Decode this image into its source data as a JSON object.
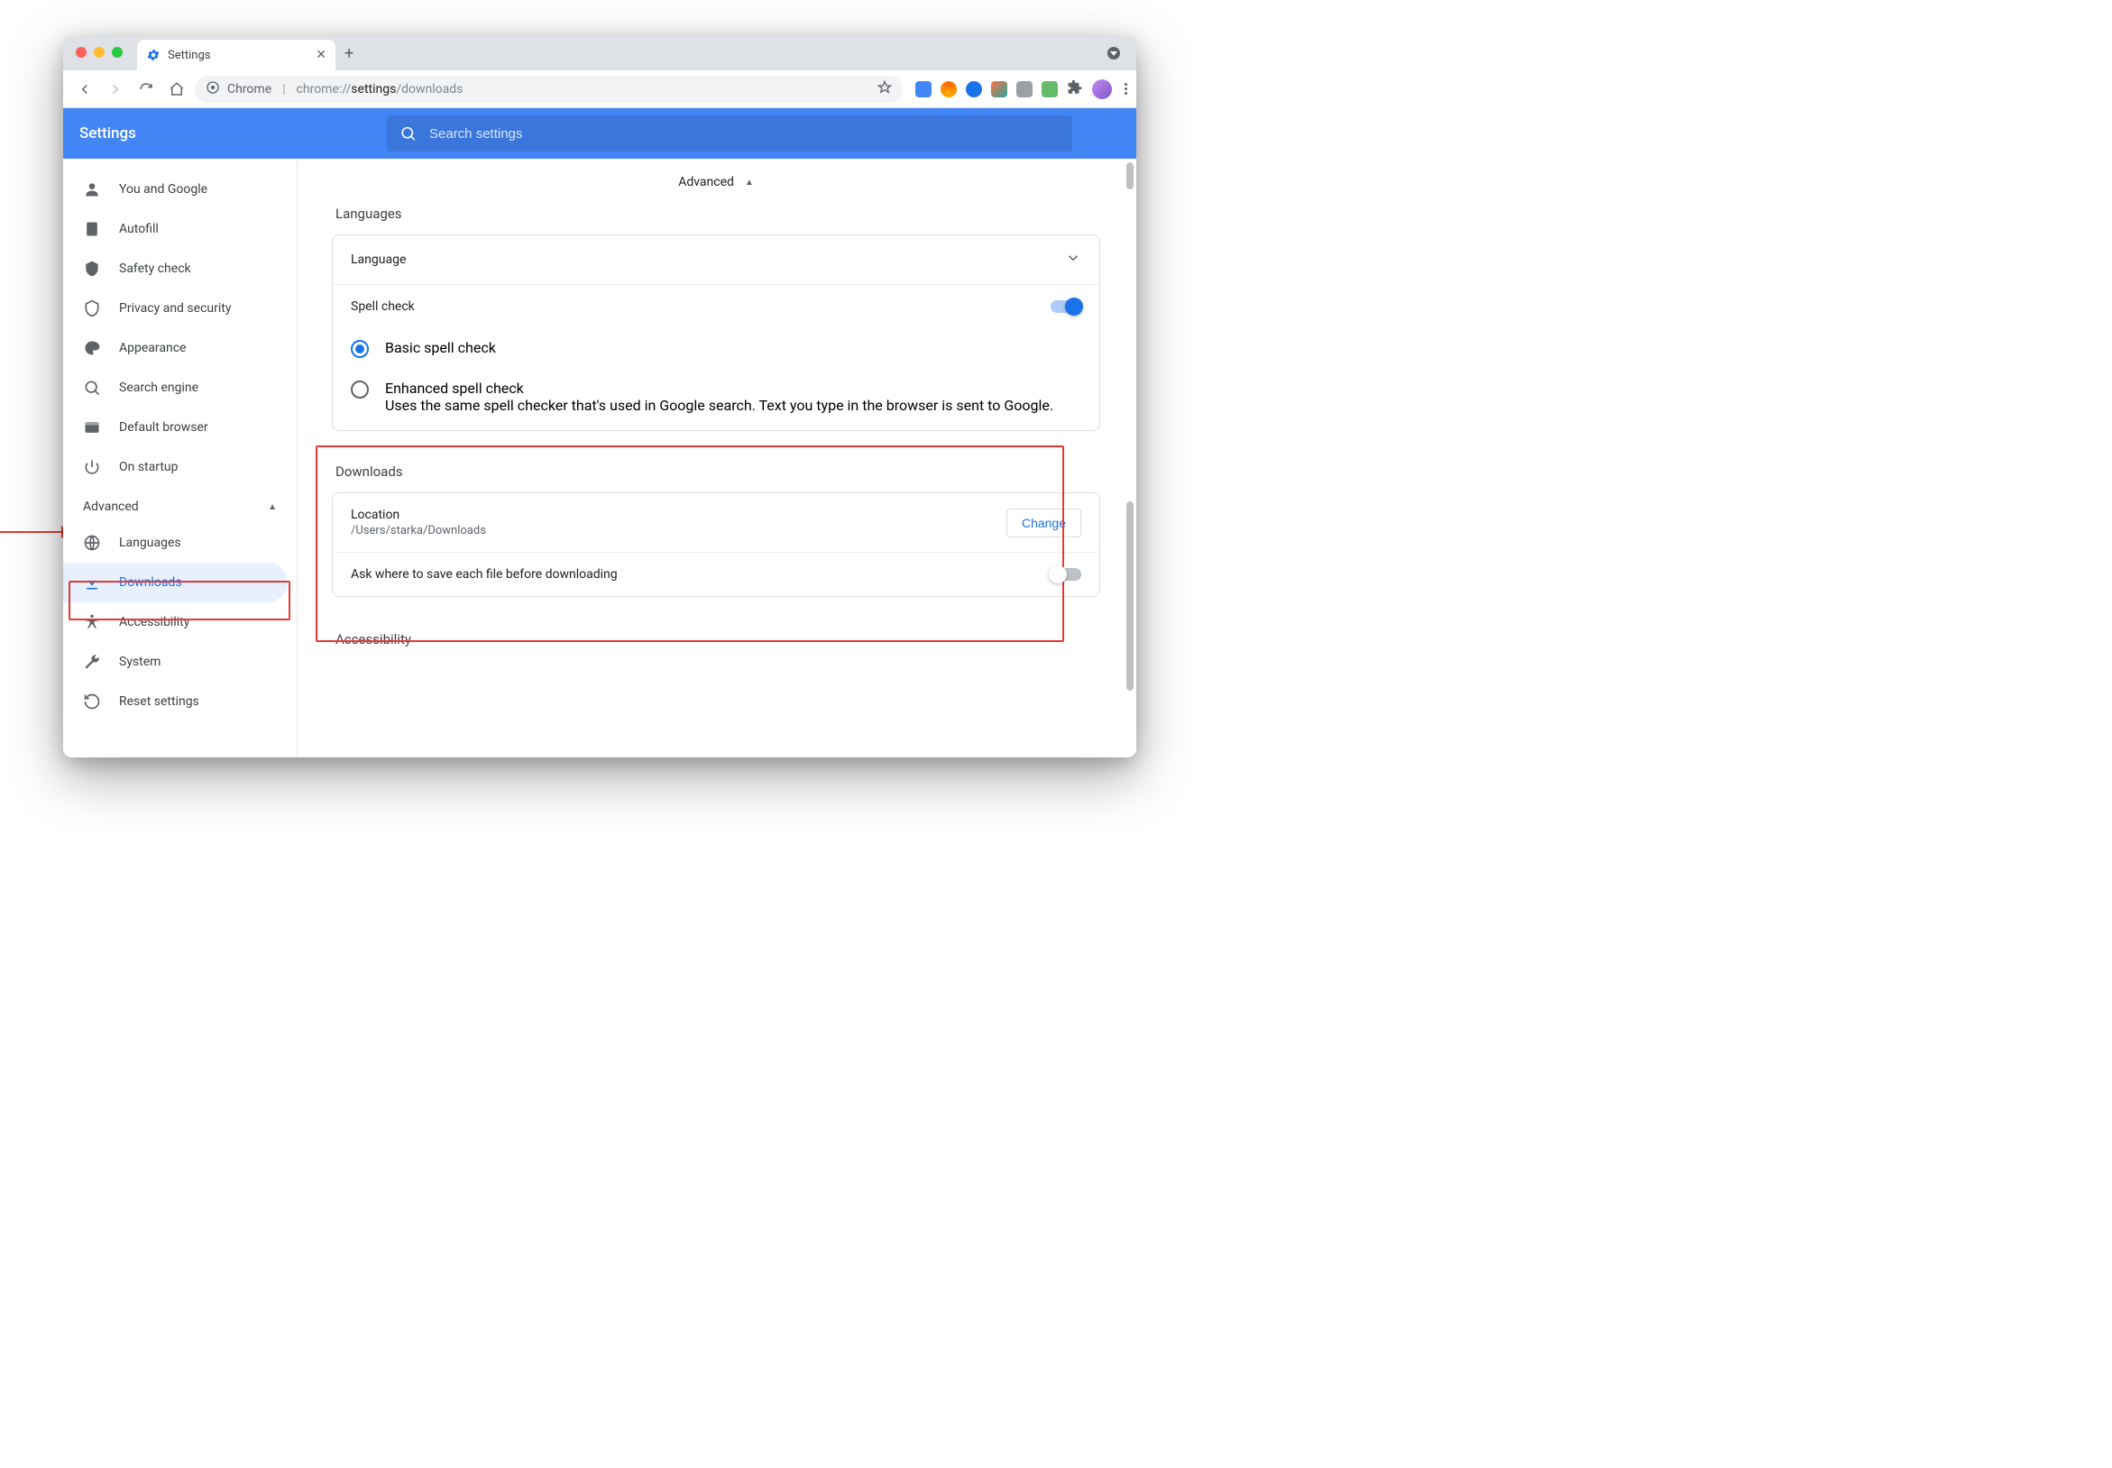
{
  "tab": {
    "title": "Settings"
  },
  "omnibox": {
    "chip": "Chrome",
    "url_prefix": "chrome://",
    "url_bold": "settings",
    "url_suffix": "/downloads"
  },
  "appbar": {
    "title": "Settings",
    "search_placeholder": "Search settings"
  },
  "sidebar": {
    "items": [
      {
        "label": "You and Google"
      },
      {
        "label": "Autofill"
      },
      {
        "label": "Safety check"
      },
      {
        "label": "Privacy and security"
      },
      {
        "label": "Appearance"
      },
      {
        "label": "Search engine"
      },
      {
        "label": "Default browser"
      },
      {
        "label": "On startup"
      }
    ],
    "advanced_label": "Advanced",
    "advanced_items": [
      {
        "label": "Languages"
      },
      {
        "label": "Downloads"
      },
      {
        "label": "Accessibility"
      },
      {
        "label": "System"
      },
      {
        "label": "Reset settings"
      }
    ]
  },
  "main": {
    "advanced_header": "Advanced",
    "languages": {
      "title": "Languages",
      "language_row": "Language",
      "spellcheck_row": "Spell check",
      "basic": "Basic spell check",
      "enhanced": "Enhanced spell check",
      "enhanced_desc": "Uses the same spell checker that's used in Google search. Text you type in the browser is sent to Google."
    },
    "downloads": {
      "title": "Downloads",
      "location_label": "Location",
      "location_path": "/Users/starka/Downloads",
      "change_btn": "Change",
      "ask_label": "Ask where to save each file before downloading"
    },
    "accessibility_title": "Accessibility"
  }
}
